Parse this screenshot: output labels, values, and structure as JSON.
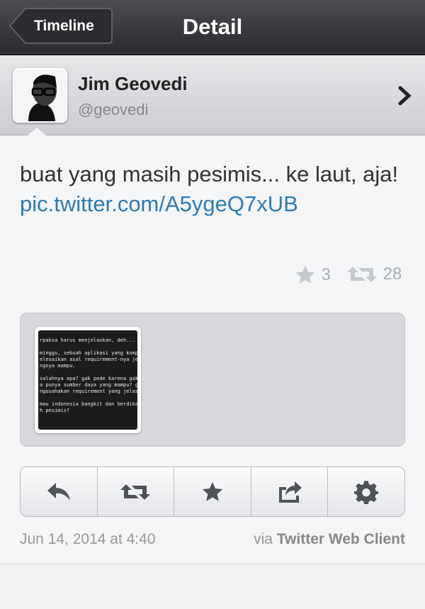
{
  "navbar": {
    "back_label": "Timeline",
    "title": "Detail"
  },
  "profile": {
    "name": "Jim Geovedi",
    "handle": "@geovedi"
  },
  "tweet": {
    "text": "buat yang masih pesimis... ke laut, aja! ",
    "link": "pic.twitter.com/A5ygeQ7xUB",
    "favorites": "3",
    "retweets": "28"
  },
  "media": {
    "lines": [
      "rpaksa harus menjelaskan, deh...",
      "",
      "minggu, sebuah aplikasi yang kompl",
      "elesaikan asal requirement-nya jel",
      "ngnya mampu.",
      "",
      "salahnya apa? gak pede karena gak",
      "a punya sumber daya yang mampu? ga",
      "ngusahakan requirement yang jelas",
      "",
      "mau indonesia bangkit dan berdika",
      "h pesimis?"
    ]
  },
  "actions": [
    "reply-icon",
    "retweet-icon",
    "star-icon",
    "share-icon",
    "gear-icon"
  ],
  "meta": {
    "timestamp": "Jun 14, 2014 at 4:40",
    "via_prefix": "via ",
    "client": "Twitter Web Client"
  },
  "colors": {
    "link": "#2e7bb3",
    "navbar": "#2a2b2e"
  }
}
